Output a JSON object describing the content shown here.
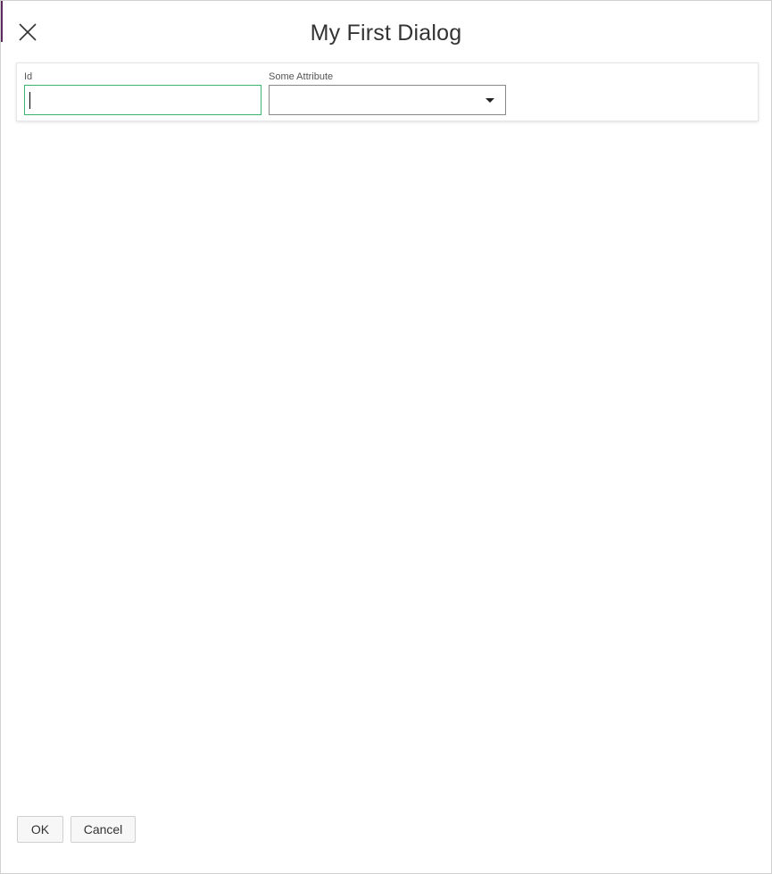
{
  "dialog": {
    "title": "My First Dialog",
    "close_icon": "close-icon"
  },
  "form": {
    "id_field": {
      "label": "Id",
      "value": "",
      "placeholder": ""
    },
    "attribute_field": {
      "label": "Some Attribute",
      "selected": "",
      "arrow_icon": "caret-down-icon"
    }
  },
  "footer": {
    "ok_label": "OK",
    "cancel_label": "Cancel"
  },
  "colors": {
    "focus_border": "#3cb371",
    "edge_accent": "#5b2a5f"
  }
}
